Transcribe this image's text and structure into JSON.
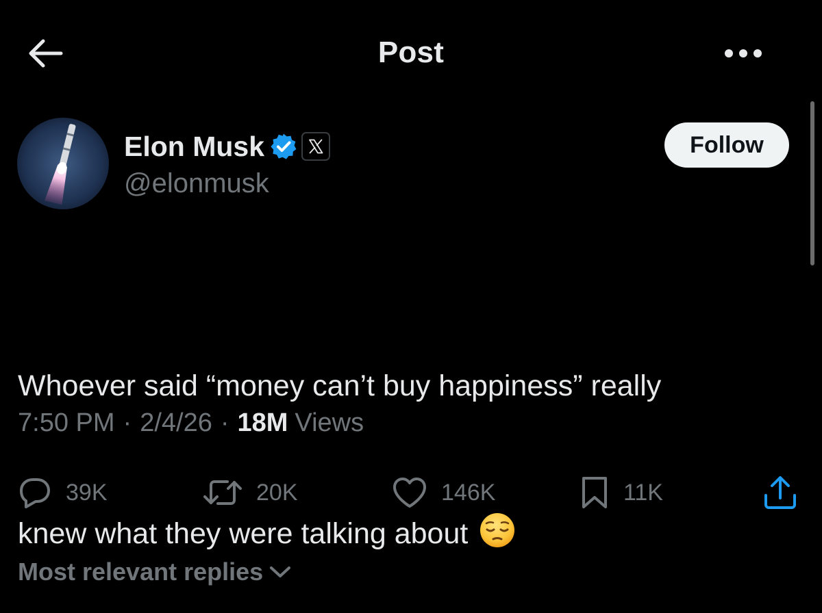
{
  "header": {
    "title": "Post",
    "back_icon": "arrow-left-icon",
    "more_icon": "more-horizontal-icon"
  },
  "author": {
    "name": "Elon Musk",
    "handle": "@elonmusk",
    "verified_badge_color": "#1d9bf0",
    "affiliate_badge": "x-logo-icon",
    "follow_label": "Follow"
  },
  "post": {
    "text_lines": [
      "Whoever said “money can’t buy happiness” really",
      "knew what they were talking about"
    ],
    "emoji": "pensive-face",
    "time": "7:50 PM",
    "date": "2/4/26",
    "views_count": "18M",
    "views_label": "Views"
  },
  "actions": {
    "replies": "39K",
    "reposts": "20K",
    "likes": "146K",
    "bookmarks": "11K",
    "share_icon": "share-icon"
  },
  "replies_sort": {
    "label": "Most relevant replies",
    "icon": "chevron-down-icon"
  },
  "colors": {
    "background": "#000000",
    "primary_text": "#e7e9ea",
    "secondary_text": "#71767b",
    "follow_button_bg": "#eff3f4"
  }
}
